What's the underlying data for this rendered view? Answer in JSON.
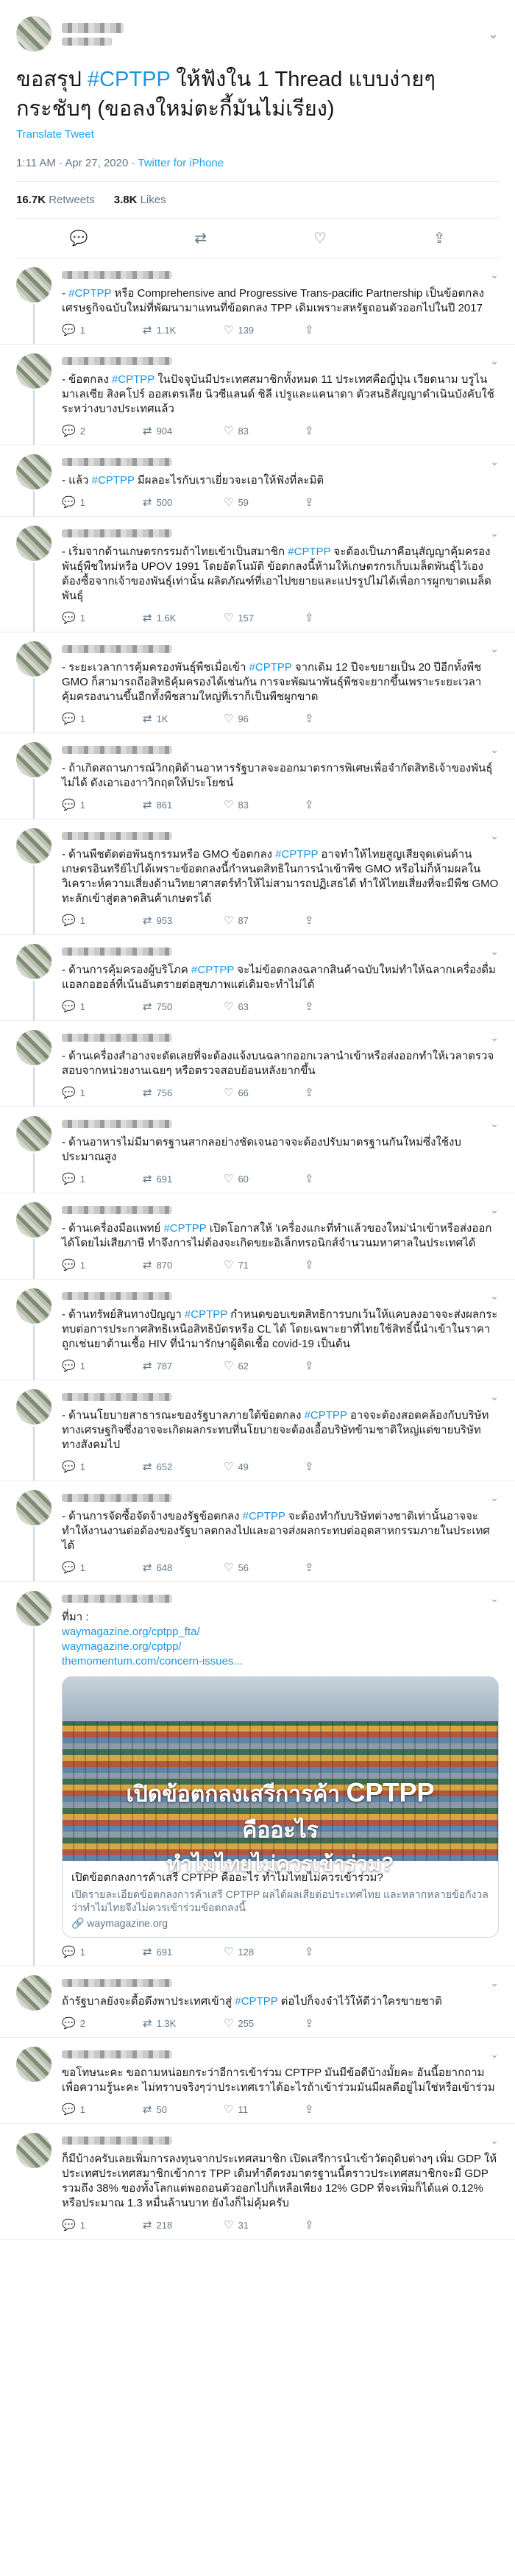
{
  "main": {
    "text_prefix": "ขอสรุป ",
    "hashtag": "#CPTPP",
    "text_suffix": " ให้ฟังใน 1 Thread แบบง่ายๆกระชับๆ (ขอลงใหม่ตะกี้มันไม่เรียง)",
    "translate": "Translate Tweet",
    "time": "1:11 AM · Apr 27, 2020 · ",
    "client": "Twitter for iPhone",
    "retweets_count": "16.7K",
    "retweets_label": "Retweets",
    "likes_count": "3.8K",
    "likes_label": "Likes"
  },
  "replies": [
    {
      "pre": "- ",
      "tag": "#CPTPP",
      "post": " หรือ Comprehensive and Progressive Trans-pacific Partnership เป็นข้อตกลงเศรษฐกิจฉบับใหม่ที่พัฒนามาแทนที่ข้อตกลง TPP เดิมเพราะสหรัฐถอนตัวออกไปในปี 2017",
      "reply": "1",
      "rt": "1.1K",
      "like": "139"
    },
    {
      "pre": "- ข้อตกลง ",
      "tag": "#CPTPP",
      "post": " ในปัจจุบันมีประเทศสมาชิกทั้งหมด 11 ประเทศคือญี่ปุ่น เวียดนาม บรูไน มาเลเซีย สิงคโปร์ ออสเตรเลีย นิวซีแลนด์ ชิลี เปรูและแคนาดา ตัวสนธิสัญญาดำเนินบังคับใช้ระหว่างบางประเทศแล้ว",
      "reply": "2",
      "rt": "904",
      "like": "83"
    },
    {
      "pre": "- แล้ว ",
      "tag": "#CPTPP",
      "post": " มีผลอะไรกับเราเยี่ยวจะเอาให้ฟังที่ละมิติ",
      "reply": "1",
      "rt": "500",
      "like": "59"
    },
    {
      "pre": "- เริ่มจากด้านเกษตรกรรมถ้าไทยเข้าเป็นสมาชิก ",
      "tag": "#CPTPP",
      "post": " จะต้องเป็นภาคีอนุสัญญาคุ้มครองพันธุ์พืชใหม่หรือ UPOV 1991 โดยอัตโนมัติ ข้อตกลงนี้ห้ามให้เกษตรกรเก็บเมล็ดพันธุ์ไว้เอง ต้องซื้อจากเจ้าของพันธุ์เท่านั้น ผลิตภัณฑ์ที่เอาไปขยายและแปรรูปไม่ได้เพื่อการผูกขาดเมล็ดพันธุ์",
      "reply": "1",
      "rt": "1.6K",
      "like": "157"
    },
    {
      "pre": "- ระยะเวลาการคุ้มครองพันธุ์พืชเมื่อเข้า ",
      "tag": "#CPTPP",
      "post": " จากเดิม 12 ปีจะขยายเป็น 20 ปีอีกทั้งพืช GMO ก็สามารถถือสิทธิคุ้มครองได้เช่นกัน การจะพัฒนาพันธุ์พืชจะยากขึ้นเพราะระยะเวลาคุ้มครองนานขึ้นอีกทั้งพืชสามใหญ่ที่เราก็เป็นพืชผูกขาด",
      "reply": "1",
      "rt": "1K",
      "like": "96"
    },
    {
      "pre": "- ถ้าเกิดสถานการณ์วิกฤติด้านอาหารรัฐบาลจะออกมาตรการพิเศษเพื่อจำกัดสิทธิเจ้าของพันธุ์ไม่ได้ ดังเอาเองาาวิกฤตให้ประโยชน์",
      "tag": "",
      "post": "",
      "reply": "1",
      "rt": "861",
      "like": "83"
    },
    {
      "pre": "- ด้านพืชตัดต่อพันธุกรรมหรือ GMO ข้อตกลง ",
      "tag": "#CPTPP",
      "post": " อาจทำให้ไทยสูญเสียจุดเด่นด้านเกษตรอินทรีย์ไปได้เพราะข้อตกลงนี้กำหนดสิทธิในการนำเข้าพืช GMO หรือไม่ก็ห้ามผลในวิเคราะห์ความเสี่ยงด้านวิทยาศาสตร์ทำให้ไม่สามารถปฏิเสธได้ ทำให้ไทยเสี่ยงที่จะมีพืช GMO ทะลักเข้าสู่ตลาดสินค้าเกษตรได้",
      "reply": "1",
      "rt": "953",
      "like": "87"
    },
    {
      "pre": "- ด้านการคุ้มครองผู้บริโภค ",
      "tag": "#CPTPP",
      "post": " จะไม่ข้อตกลงฉลากสินค้าฉบับใหม่ทำให้ฉลากเครื่องดื่มแอลกอฮอล์ที่เน้นอันตรายต่อสุขภาพแต่เดิมจะทำไม่ได้",
      "reply": "1",
      "rt": "750",
      "like": "63"
    },
    {
      "pre": "- ด้านเครื่องสำอางจะตัดเลยที่จะต้องแจ้งบนฉลากออกเวลานำเข้าหรือส่งออกทำให้เวลาตรวจสอบจากหน่วยงานเฉยๆ หรือตรวจสอบย้อนหลังยากขึ้น",
      "tag": "",
      "post": "",
      "reply": "1",
      "rt": "756",
      "like": "66"
    },
    {
      "pre": "- ด้านอาหารไม่มีมาตรฐานสากลอย่างชัดเจนอาจจะต้องปรับมาตรฐานกันใหม่ซึ่งใช้งบประมาณสูง",
      "tag": "",
      "post": "",
      "reply": "1",
      "rt": "691",
      "like": "60"
    },
    {
      "pre": "- ด้านเครื่องมือแพทย์ ",
      "tag": "#CPTPP",
      "post": " เปิดโอกาสให้ 'เครื่องแกะที่ทำแล้วของใหม่'นำเข้าหรือส่งออกได้โดยไม่เสียภาษี ทำจึงการไม่ต้องจะเกิดขยะอิเล็กทรอนิกส์จำนวนมหาศาลในประเทศได้",
      "reply": "1",
      "rt": "870",
      "like": "71"
    },
    {
      "pre": "- ด้านทรัพย์สินทางปัญญา ",
      "tag": "#CPTPP",
      "post": " กำหนดขอบเขตสิทธิการบกเว้นให้แคบลงอาจจะส่งผลกระทบต่อการประกาศสิทธิเหนือสิทธิบัตรหรือ CL ได้ โดยเฉพาะยาที่ไทยใช้สิทธิ์นี้นำเข้าในราคาถูกเช่นยาต้านเชื้อ HIV ที่นำมารักษาผู้ติดเชื้อ covid-19 เป็นต้น",
      "reply": "1",
      "rt": "787",
      "like": "62"
    },
    {
      "pre": "- ด้านนโยบายสาธารณะของรัฐบาลภายใต้ข้อตกลง ",
      "tag": "#CPTPP",
      "post": " อาจจะต้องสอดคล้องกับบริษัททางเศรษฐกิจซึ่งอาจจะเกิดผลกระทบที่นโยบายจะต้องเอื้อบริษัทข้ามชาติใหญ่แต่ขายบริษัททางสังคมไป",
      "reply": "1",
      "rt": "652",
      "like": "49"
    },
    {
      "pre": "- ด้านการจัดซื้อจัดจ้างของรัฐข้อตกลง ",
      "tag": "#CPTPP",
      "post": " จะต้องทำกับบริษัทต่างชาติเท่านั้นอาจจะทำให้งานงานต่อต้องของรัฐบาลตกลงไปและอาจส่งผลกระทบต่ออุตสาหกรรมภายในประเทศได้",
      "reply": "1",
      "rt": "648",
      "like": "56"
    }
  ],
  "source_reply": {
    "label": "ที่มา :",
    "links": [
      "waymagazine.org/cptpp_fta/",
      "waymagazine.org/cptpp/",
      "themomentum.com/concern-issues..."
    ],
    "card_title_1a": "เปิดข้อตกลงเสรีการค้า ",
    "card_title_1b": "CPTPP",
    "card_title_2": "คืออะไร",
    "card_title_3": "ทำไมไทยไม่ควรเข้าร่วม?",
    "card_heading": "เปิดข้อตกลงการค้าเสรี CPTPP คืออะไร ทำไมไทยไม่ควรเข้าร่วม?",
    "card_desc": "เปิดรายละเอียดข้อตกลงการค้าเสรี CPTPP ผลได้ผลเสียต่อประเทศไทย และหลากหลายข้อกังวลว่าทำไมไทยจึงไม่ควรเข้าร่วมข้อตกลงนี้",
    "card_url": "waymagazine.org",
    "reply": "1",
    "rt": "691",
    "like": "128"
  },
  "tail_replies": [
    {
      "pre": "ถ้ารัฐบาลยังจะดื้อดึงพาประเทศเข้าสู่ ",
      "tag": "#CPTPP",
      "post": " ต่อไปก็จงจำไว้ให้ดีว่าใครขายชาติ",
      "reply": "2",
      "rt": "1.3K",
      "like": "255"
    },
    {
      "pre": "ขอโทษนะคะ ขอถามหน่อยกระว่าอีการเข้าร่วม CPTPP มันมีข้อดีบ้างมั้ยคะ อันนี้อยากถามเพื่อความรู้นะคะ ไม่ทราบจริงๆว่าประเทศเราได้อะไรถ้าเข้าร่วมมันมีผลดีอยู่ไม่ใช่หรือเข้าร่วม",
      "tag": "",
      "post": "",
      "reply": "1",
      "rt": "50",
      "like": "11"
    },
    {
      "pre": "ก็มีบ้างครับเลยเพิ่มการลงทุนจากประเทศสมาชิก เปิดเสรีการนำเข้าวัตถุดิบต่างๆ เพิ่ม GDP ให้ประเทศประเทศสมาชิกเข้าการ TPP เดิมทำดีตรงมาตรฐานนี้ตราวประเทศสมาชิกจะมี GDP รวมถึง 38% ของทั้งโลกแต่พอถอนตัวออกไปก็เหลือเพียง 12% GDP ที่จะเพิ่มก็ได้แค่ 0.12% หรือประมาณ 1.3 หมื่นล้านบาท ยังไงก็ไม่คุ้มครับ",
      "tag": "",
      "post": "",
      "reply": "1",
      "rt": "218",
      "like": "31"
    }
  ],
  "icons": {
    "reply": "reply-icon",
    "retweet": "retweet-icon",
    "like": "heart-icon",
    "share": "share-icon",
    "more": "chevron-down-icon"
  }
}
